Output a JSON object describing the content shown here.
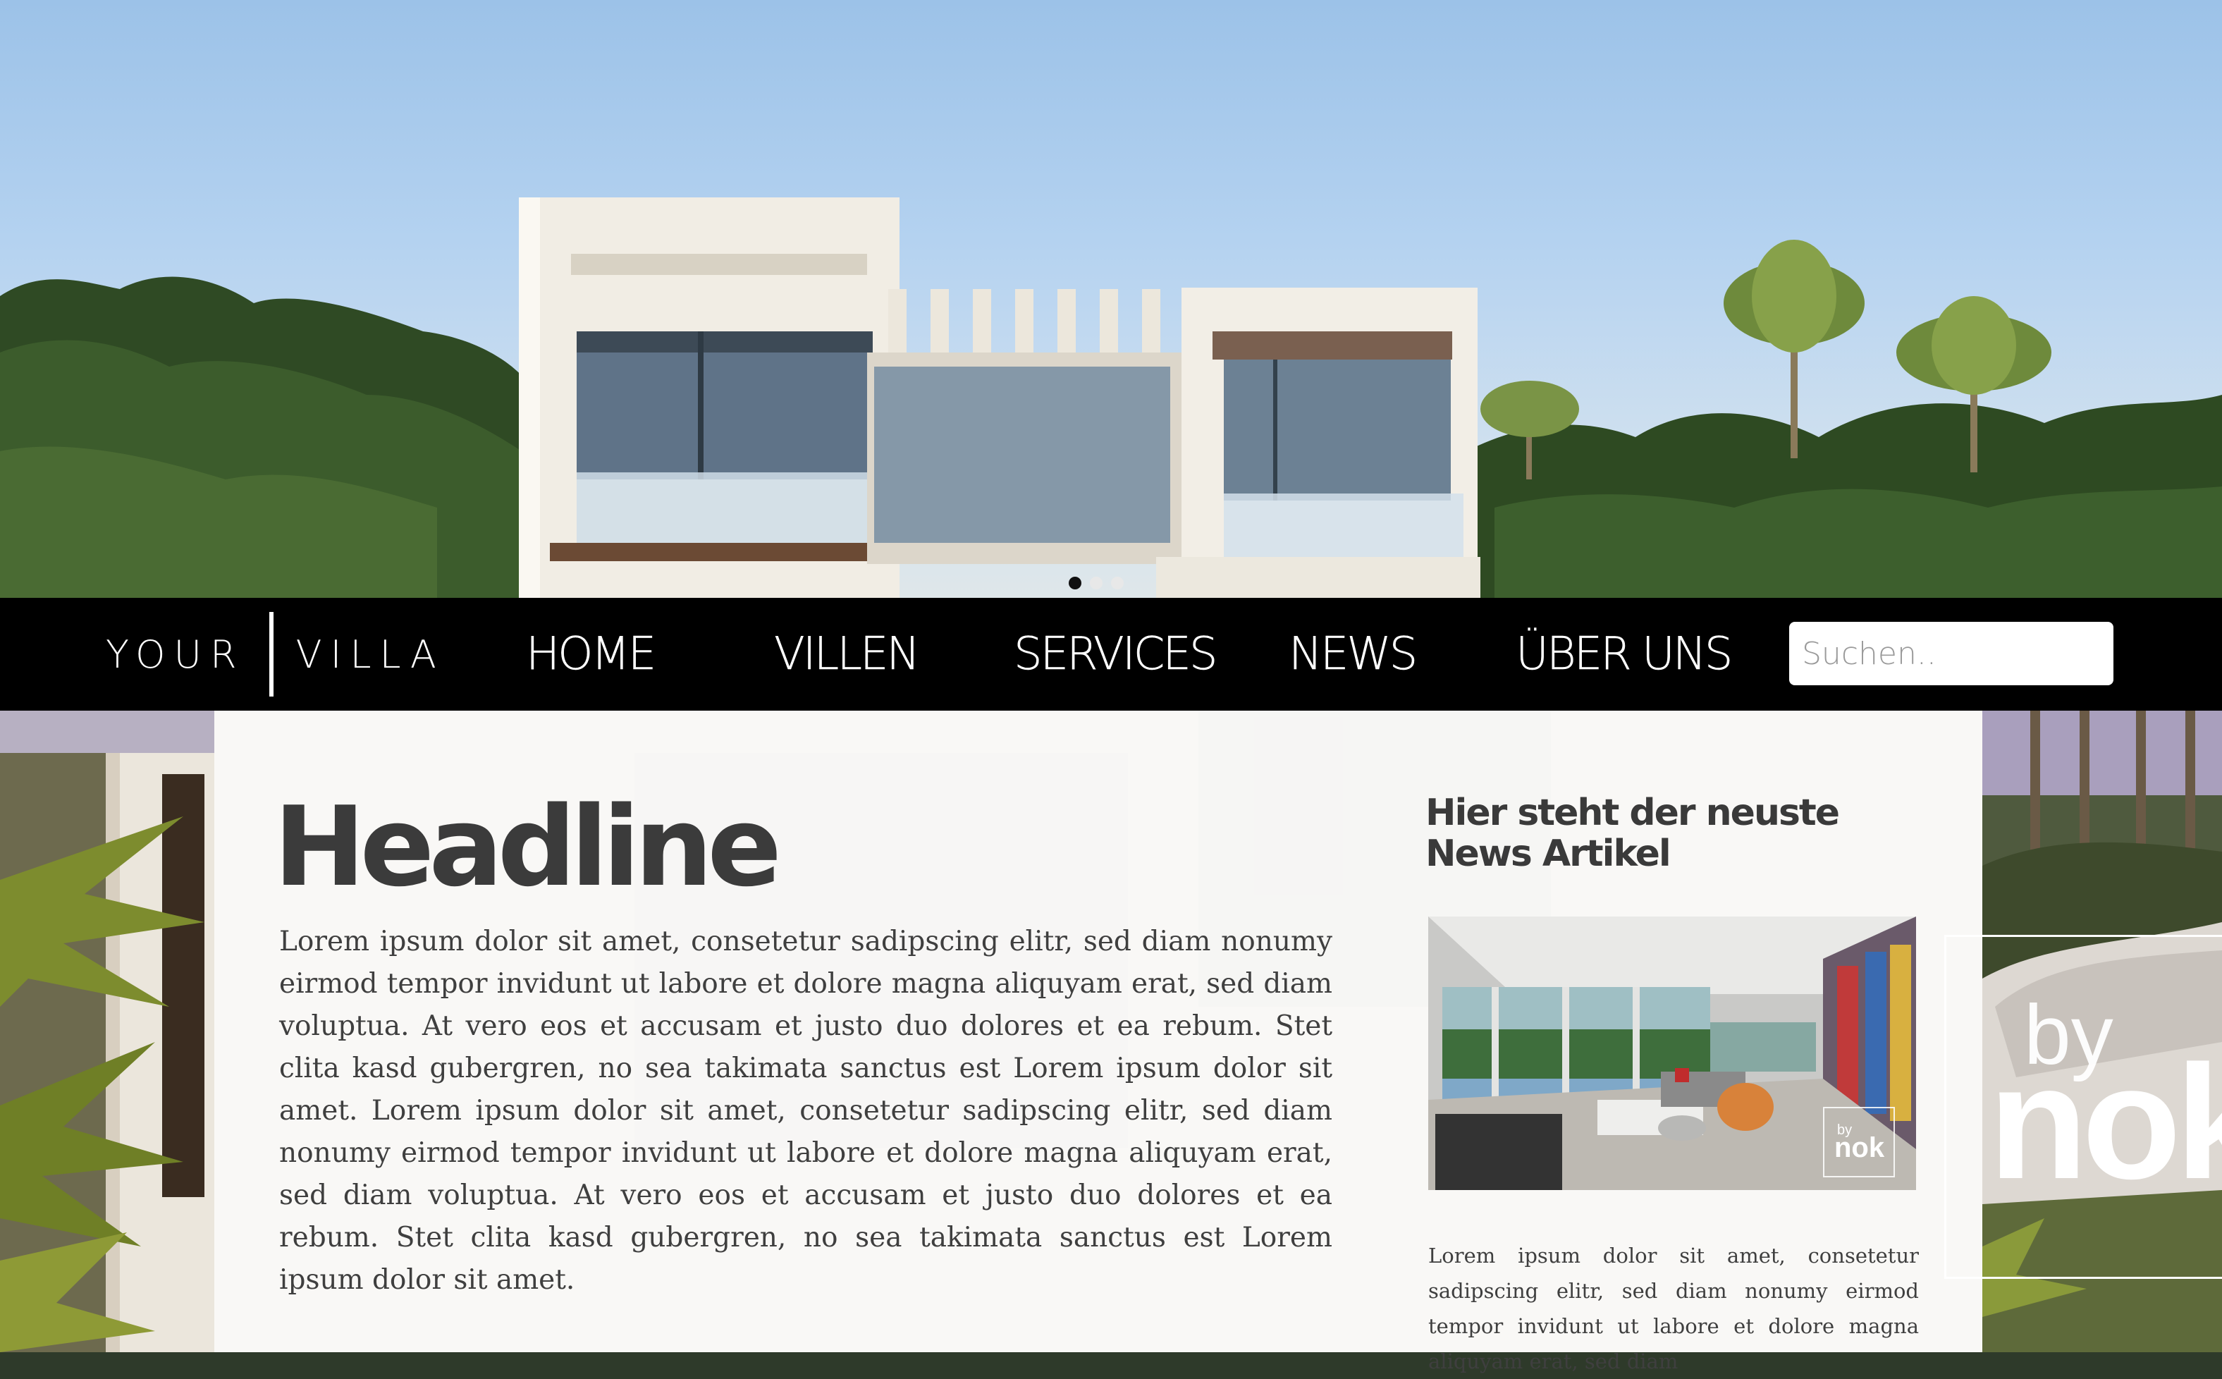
{
  "logo": {
    "part1": "YOUR",
    "part2": "VILLA"
  },
  "nav": {
    "items": [
      {
        "label": "HOME"
      },
      {
        "label": "VILLEN"
      },
      {
        "label": "SERVICES"
      },
      {
        "label": "NEWS"
      },
      {
        "label": "ÜBER UNS"
      }
    ]
  },
  "search": {
    "placeholder": "Suchen..",
    "value": ""
  },
  "slider": {
    "slide_count": 3,
    "active_index": 0
  },
  "main": {
    "headline": "Headline",
    "body": "Lorem ipsum dolor sit amet, consetetur sadipscing elitr, sed diam nonumy eirmod tempor invidunt ut labore et dolore magna aliquyam erat, sed diam voluptua. At vero eos et accusam et justo duo dolores et ea rebum. Stet clita kasd gubergren, no sea takimata sanctus est Lorem ipsum dolor sit amet. Lorem ipsum dolor sit amet, consetetur sadipscing elitr, sed diam nonumy eirmod tempor invidunt ut labore et dolore magna aliquyam erat, sed diam voluptua. At vero eos et accusam et justo duo dolores et ea rebum. Stet clita kasd gubergren, no sea takimata sanctus est Lorem ipsum dolor sit amet."
  },
  "news": {
    "title": "Hier steht der neuste News Artikel",
    "image_badge": {
      "by": "by",
      "brand": "nok"
    },
    "excerpt": "Lorem ipsum dolor sit amet, consetetur sadipscing elitr, sed diam nonumy eirmod tempor invidunt ut labore et dolore magna aliquyam erat, sed diam"
  },
  "brand": {
    "by": "by",
    "name": "nok"
  },
  "colors": {
    "nav_background": "#000000",
    "nav_text": "#ffffff",
    "headline": "#3b3b3b",
    "body_text": "#3f3f3f",
    "panel": "#ffffff"
  }
}
